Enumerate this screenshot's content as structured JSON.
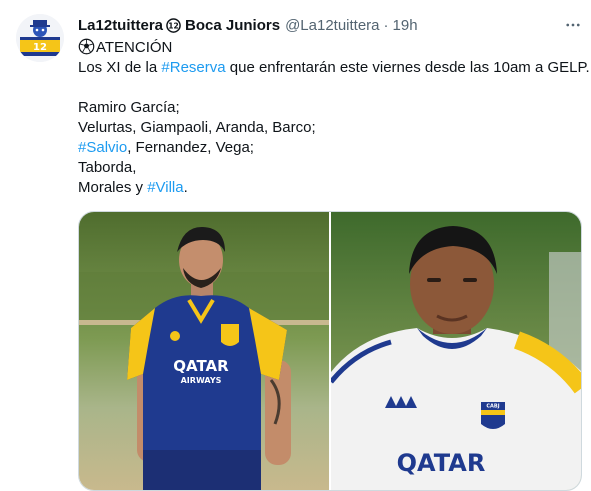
{
  "tweet": {
    "author_name": "La12tuittera",
    "author_suffix": "Boca Juniors",
    "handle": "@La12tuittera",
    "separator": "·",
    "time": "19h",
    "avatar_text": "12",
    "text": {
      "line1_word": "ATENCIÓN",
      "line2_prefix": "Los XI de la ",
      "line2_hashtag": "#Reserva",
      "line2_suffix": " que enfrentarán este viernes desde las 10am a GELP.",
      "line3": "Ramiro García;",
      "line4": "Velurtas, Giampaoli, Aranda, Barco;",
      "line5_hashtag": "#Salvio",
      "line5_suffix": ", Fernandez, Vega;",
      "line6": "Taborda,",
      "line7_prefix": "Morales y ",
      "line7_hashtag": "#Villa",
      "line7_suffix": "."
    },
    "media": {
      "left_photo_sponsor": "QATAR",
      "left_photo_sponsor_sub": "AIRWAYS",
      "right_photo_sponsor": "QATAR",
      "crest_text": "CABJ"
    }
  },
  "colors": {
    "hashtag": "#1d9bf0",
    "text": "#0f1419",
    "secondary": "#536471",
    "jersey_blue": "#1f3a8f",
    "jersey_yellow": "#f5c518"
  },
  "icons": {
    "badge": "boca-crest-icon",
    "more": "more-options-icon",
    "emoji": "soccer-ball-icon"
  }
}
